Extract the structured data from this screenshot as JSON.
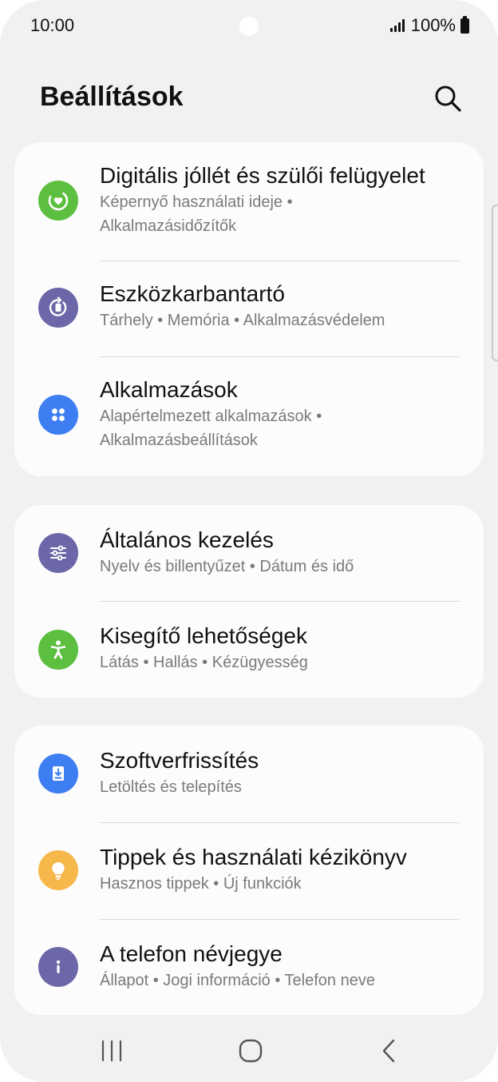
{
  "status_bar": {
    "time": "10:00",
    "battery": "100%"
  },
  "header": {
    "title": "Beállítások"
  },
  "colors": {
    "green": "#5cbf3f",
    "purple": "#6c67a8",
    "blue": "#3d7ef2",
    "yellow": "#f7b84b",
    "background": "#f1f1f3",
    "card": "#fcfcfd"
  },
  "groups": [
    {
      "items": [
        {
          "title": "Digitális jóllét és szülői felügyelet",
          "subtitle_line1": "Képernyő használati ideje  •",
          "subtitle_line2": "Alkalmazásidőzítők",
          "icon": "digital-wellbeing-icon"
        },
        {
          "title": "Eszközkarbantartó",
          "subtitle_line1": "Tárhely  •  Memória  •  Alkalmazásvédelem",
          "icon": "device-care-icon"
        },
        {
          "title": "Alkalmazások",
          "subtitle_line1": "Alapértelmezett alkalmazások  •",
          "subtitle_line2": "Alkalmazásbeállítások",
          "icon": "apps-icon"
        }
      ]
    },
    {
      "items": [
        {
          "title": "Általános kezelés",
          "subtitle_line1": "Nyelv és billentyűzet  •  Dátum és idő",
          "icon": "sliders-icon"
        },
        {
          "title": "Kisegítő lehetőségek",
          "subtitle_line1": "Látás  •  Hallás  •  Kézügyesség",
          "icon": "accessibility-icon"
        }
      ]
    },
    {
      "items": [
        {
          "title": "Szoftverfrissítés",
          "subtitle_line1": "Letöltés és telepítés",
          "icon": "download-icon"
        },
        {
          "title": "Tippek és használati kézikönyv",
          "subtitle_line1": "Hasznos tippek  •  Új funkciók",
          "icon": "lightbulb-icon"
        },
        {
          "title": "A telefon névjegye",
          "subtitle_line1": "Állapot  •  Jogi információ  •  Telefon neve",
          "icon": "info-icon"
        }
      ]
    }
  ],
  "navbar": {
    "icons": [
      "recent-apps-icon",
      "home-icon",
      "back-icon"
    ]
  }
}
